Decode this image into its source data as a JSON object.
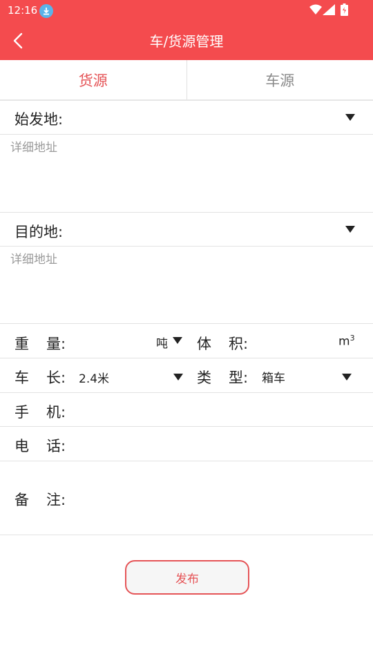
{
  "status_bar": {
    "time": "12:16"
  },
  "header": {
    "title": "车/货源管理"
  },
  "tabs": [
    {
      "label": "货源",
      "active": true
    },
    {
      "label": "车源",
      "active": false
    }
  ],
  "form": {
    "origin": {
      "label": "始发地:",
      "detail_placeholder": "详细地址"
    },
    "destination": {
      "label": "目的地:",
      "detail_placeholder": "详细地址"
    },
    "weight": {
      "label_a": "重",
      "label_b": "量:",
      "unit": "吨"
    },
    "volume": {
      "label_a": "体",
      "label_b": "积:",
      "unit": "m",
      "unit_sup": "3"
    },
    "length": {
      "label_a": "车",
      "label_b": "长:",
      "value": "2.4米"
    },
    "type": {
      "label_a": "类",
      "label_b": "型:",
      "value": "箱车"
    },
    "mobile": {
      "label_a": "手",
      "label_b": "机:"
    },
    "phone": {
      "label_a": "电",
      "label_b": "话:"
    },
    "remark": {
      "label_a": "备",
      "label_b": "注:"
    }
  },
  "publish_label": "发布",
  "colors": {
    "accent": "#f44b4e",
    "accent_text": "#e55356"
  }
}
